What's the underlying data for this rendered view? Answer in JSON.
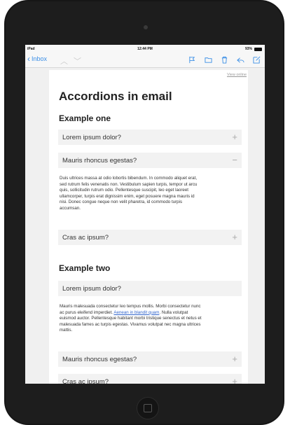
{
  "statusbar": {
    "carrier": "iPad",
    "time": "12:44 PM",
    "battery": "93%"
  },
  "nav": {
    "back_label": "Inbox"
  },
  "email": {
    "view_online": "View online",
    "title": "Accordions in email",
    "sections": [
      {
        "heading": "Example one",
        "items": [
          {
            "label": "Lorem ipsum dolor?",
            "symbol": "+"
          },
          {
            "label": "Mauris rhoncus egestas?",
            "symbol": "−",
            "lines": [
              "Duis ultrices massa at odio lobortis bibendum. In commodo aliquet erat,",
              "sed rutrum felis venenatis non. Vestibulum sapien turpis, tempor ut arcu",
              "quis, sollicitudin rutrum odio. Pellentesque suscipit, leo eget laoreet",
              "ullamcorper, turpis erat dignissim enim, eget posuere magna mauris id",
              "nisi. Donec congue neque non velit pharetra, id commodo turpis",
              "accumsan."
            ]
          },
          {
            "label": "Cras ac ipsum?",
            "symbol": "+"
          }
        ]
      },
      {
        "heading": "Example two",
        "items": [
          {
            "label": "Lorem ipsum dolor?",
            "lines": [
              "Mauris malesuada consectetur leo tempus mollis. Morbi consectetur nunc",
              "euismod auctor. Pellentesque habitant morbi tristique senectus et netus et",
              "malesuada fames ac turpis egestas. Vivamus volutpat nec magna ultrices",
              "mattis."
            ],
            "line2_pre": "ac purus eleifend imperdiet. ",
            "line2_link": "Aenean in blandit quam",
            "line2_post": ". Nulla volutpat"
          },
          {
            "label": "Mauris rhoncus egestas?",
            "symbol": "+"
          },
          {
            "label": "Cras ac ipsum?",
            "symbol": "+"
          }
        ]
      }
    ]
  }
}
